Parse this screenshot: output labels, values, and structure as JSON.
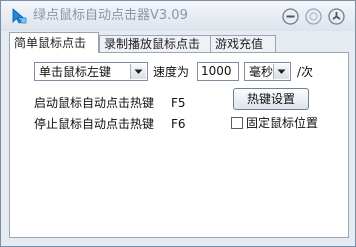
{
  "window": {
    "title": "绿点鼠标自动点击器V3.09"
  },
  "tabs": [
    {
      "label": "简单鼠标点击",
      "active": true
    },
    {
      "label": "录制播放鼠标点击",
      "active": false
    },
    {
      "label": "游戏充值",
      "active": false
    }
  ],
  "simple_click": {
    "mouse_button": {
      "selected": "单击鼠标左键"
    },
    "speed": {
      "label": "速度为",
      "value": "1000"
    },
    "unit": {
      "selected": "毫秒",
      "suffix": "/次"
    },
    "start_hotkey": {
      "label": "启动鼠标自动点击热键",
      "value": "F5"
    },
    "stop_hotkey": {
      "label": "停止鼠标自动点击热键",
      "value": "F6"
    },
    "hotkey_settings_button": "热键设置",
    "fix_mouse_position": {
      "label": "固定鼠标位置",
      "checked": false
    }
  },
  "icons": {
    "app": "mouse-cursor-icon",
    "minimize": "minimize-icon",
    "maximize": "maximize-icon",
    "close": "close-icon"
  },
  "colors": {
    "title_text": "#8a96a6",
    "app_icon": "#1e88d8",
    "border": "#9aa6b6"
  }
}
